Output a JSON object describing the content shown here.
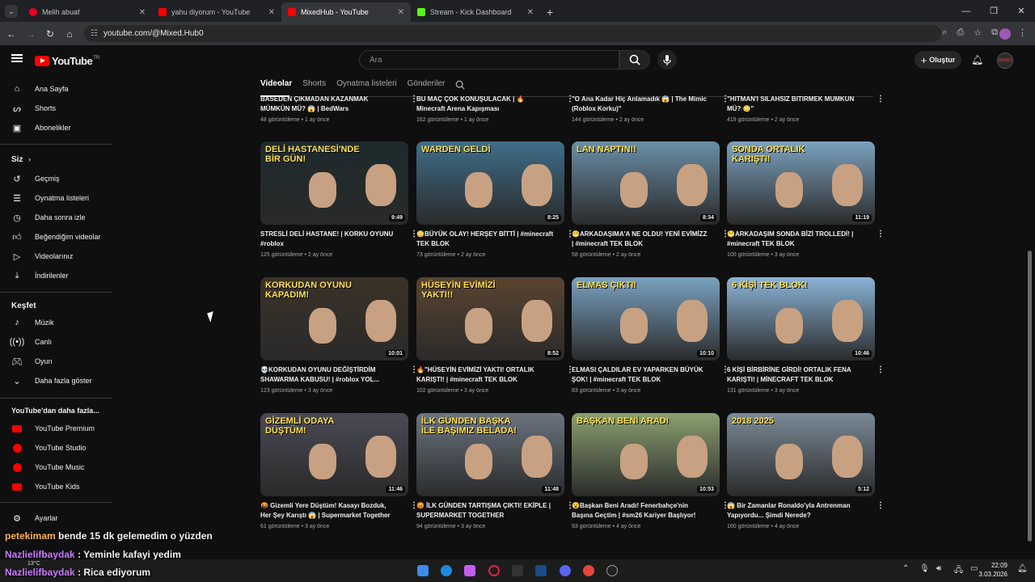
{
  "browser": {
    "tabs": [
      {
        "label": "Melih abuaf",
        "color": "#e60023"
      },
      {
        "label": "yahu diyorum - YouTube",
        "color": "#ff0000"
      },
      {
        "label": "MixedHub - YouTube",
        "color": "#ff0000"
      },
      {
        "label": "Stream - Kick Dashboard",
        "color": "#53fc18"
      }
    ],
    "url": "youtube.com/@Mixed.Hub0"
  },
  "header": {
    "logo": "YouTube",
    "country": "TR",
    "search_placeholder": "Ara",
    "create_label": "Oluştur",
    "avatar_text": "MIXED"
  },
  "sidebar": {
    "main": [
      "Ana Sayfa",
      "Shorts",
      "Abonelikler"
    ],
    "you_title": "Siz",
    "you": [
      "Geçmiş",
      "Oynatma listeleri",
      "Daha sonra izle",
      "Beğendiğim videolar",
      "Videolarınız",
      "İndirilenler"
    ],
    "explore_title": "Keşfet",
    "explore": [
      "Müzik",
      "Canlı",
      "Oyun",
      "Daha fazla göster"
    ],
    "more_title": "YouTube'dan daha fazla...",
    "more": [
      "YouTube Premium",
      "YouTube Studio",
      "YouTube Music",
      "YouTube Kids"
    ],
    "settings": "Ayarlar"
  },
  "channel_tabs": [
    "Videolar",
    "Shorts",
    "Oynatma listeleri",
    "Gönderiler"
  ],
  "videos": [
    {
      "title": "BASEDEN ÇIKMADAN KAZANMAK MÜMKÜN MÜ? 😱 | BedWars",
      "meta": "48 görüntüleme • 1 ay önce"
    },
    {
      "title": "BU MAÇ ÇOK KONUŞULACAK | 🔥 Minecraft Arena Kapışması",
      "meta": "162 görüntüleme • 1 ay önce"
    },
    {
      "title": "\"O Ana Kadar Hiç Anlamadık 😱 | The Mimic (Roblox Korku)\"",
      "meta": "144 görüntüleme • 2 ay önce"
    },
    {
      "title": "\"HITMAN'I SILAHSIZ BITIRMEK MUMKUN MÜ? 😳\"",
      "meta": "419 görüntüleme • 2 ay önce"
    },
    {
      "title": "STRESLİ DELİ HASTANE! | KORKU OYUNU #roblox",
      "meta": "125 görüntüleme • 2 ay önce",
      "duration": "9:49",
      "overlay": "DELİ HASTANESİ'NDE BİR GÜN!",
      "bg": "#1d2a2c"
    },
    {
      "title": "😳BÜYÜK OLAY! HERŞEY BİTTİ | #minecraft TEK BLOK",
      "meta": "73 görüntüleme • 2 ay önce",
      "duration": "8:25",
      "overlay": "WARDEN GELDİ",
      "bg": "#3f6e8a"
    },
    {
      "title": "😬ARKADAŞIMA'A NE OLDU! YENİ EVİMİZZ | #minecraft TEK BLOK",
      "meta": "58 görüntüleme • 2 ay önce",
      "duration": "8:34",
      "overlay": "LAN NAPTIN!!",
      "bg": "#6a8fa8"
    },
    {
      "title": "😬ARKADAŞIM SONDA BİZİ TROLLEDİ! | #minecraft TEK BLOK",
      "meta": "100 görüntüleme • 3 ay önce",
      "duration": "11:19",
      "overlay": "SONDA ORTALIK KARIŞTI!",
      "bg": "#7ba2bf"
    },
    {
      "title": "💀KORKUDAN OYUNU DEĞİŞTİRDİM SHAWARMA KABUSU! | #roblox YOL...",
      "meta": "123 görüntüleme • 3 ay önce",
      "duration": "10:01",
      "overlay": "KORKUDAN OYUNU KAPADIM!",
      "bg": "#3a3228"
    },
    {
      "title": "🔥\"HÜSEYİN EVİMİZİ YAKTI! ORTALIK KARIŞTI! | #minecraft TEK BLOK",
      "meta": "102 görüntüleme • 3 ay önce",
      "duration": "8:52",
      "overlay": "HÜSEYİN EVİMİZİ YAKTI!!",
      "bg": "#5a4430"
    },
    {
      "title": "ELMASI ÇALDILAR EV YAPARKEN BÜYÜK ŞOK! | #minecraft TEK BLOK",
      "meta": "83 görüntüleme • 3 ay önce",
      "duration": "10:10",
      "overlay": "ELMAS ÇIKTI!",
      "bg": "#7aa1c0"
    },
    {
      "title": "6 KİŞİ BİRBİRİNE GİRDİ! ORTALIK FENA KARIŞTI! | MİNECRAFT TEK BLOK",
      "meta": "131 görüntüleme • 3 ay önce",
      "duration": "10:46",
      "overlay": "6 KİŞİ TEK BLOK!",
      "bg": "#8ab3d6"
    },
    {
      "title": "🤬 Gizemli Yere Düştüm! Kasayı Bozduk, Her Şey Karıştı 😱 | Supermarket Together",
      "meta": "61 görüntüleme • 3 ay önce",
      "duration": "11:46",
      "overlay": "GİZEMLİ ODAYA DÜŞTÜM!",
      "bg": "#4a4a55"
    },
    {
      "title": "😡 İLK GÜNDEN TARTIŞMA ÇIKTI! EKİPLE | SUPERMARKET TOGETHER",
      "meta": "94 görüntüleme • 3 ay önce",
      "duration": "11:48",
      "overlay": "İLK GÜNDEN BAŞKA İLE BAŞIMIZ BELADA!",
      "bg": "#6b7480"
    },
    {
      "title": "😮Başkan Beni Aradı! Fenerbahçe'nin Başına Geçtim | #sm26 Kariyer Başlıyor!",
      "meta": "93 görüntüleme • 4 ay önce",
      "duration": "10:53",
      "overlay": "BAŞKAN BENİ ARADI",
      "bg": "#8aa070"
    },
    {
      "title": "😱 Bir Zamanlar Ronaldo'yla Antrenman Yapıyordu... Şimdi Nerede?",
      "meta": "160 görüntüleme • 4 ay önce",
      "duration": "5:12",
      "overlay": "2018 2025",
      "bg": "#7a8a98"
    }
  ],
  "chat": [
    {
      "user": "petekimam",
      "msg": "bende 15 dk gelemedim o yüzden",
      "color": "#ffb347"
    },
    {
      "user": "Nazlielifbaydak",
      "msg": ": Yeminle kafayi yedim",
      "color": "#c97cff"
    },
    {
      "user": "Nazlielifbaydak",
      "msg": ": Rica ediyorum",
      "color": "#c97cff"
    }
  ],
  "taskbar": {
    "weather": "13°C",
    "time": "22:09",
    "date": "3.03.2026"
  }
}
